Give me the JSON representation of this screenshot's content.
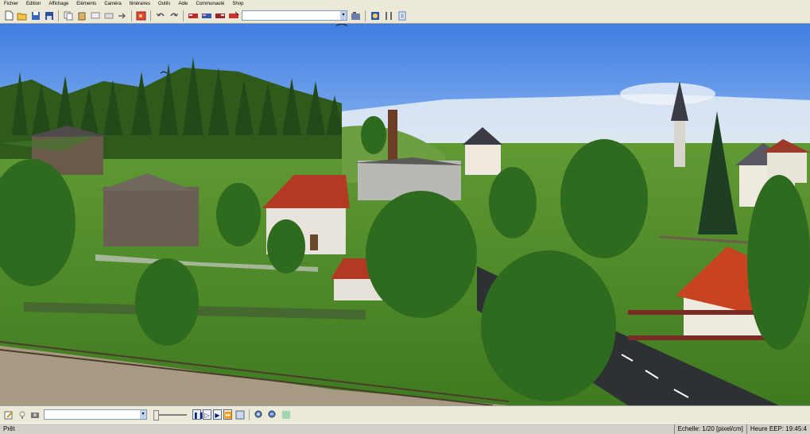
{
  "menu": {
    "items": [
      "Fichier",
      "Edition",
      "Affichage",
      "Eléments",
      "Caméra",
      "Itinéraires",
      "Outils",
      "Aide",
      "Communauté",
      "Shop"
    ]
  },
  "toolbar": {
    "icons": [
      "new-file-icon",
      "open-folder-icon",
      "save-icon",
      "save-as-icon",
      "copy-icon",
      "paste-icon",
      "cut-icon",
      "insert-icon",
      "export-icon",
      "picture-icon",
      "undo-icon",
      "redo-icon",
      "train-icon",
      "train-add-icon",
      "train-edit-icon",
      "train-remove-icon",
      "combo",
      "camera-icon",
      "sun-icon",
      "tools-icon",
      "document-icon"
    ],
    "combo_value": ""
  },
  "bottom": {
    "combo_value": "",
    "slider_level": 0
  },
  "status": {
    "text": "Prêt",
    "scale": "Echelle:  1/20 [pixel/cm]",
    "time": "Heure EEP:  19:45:4"
  },
  "colors": {
    "sky": "#4f86e0",
    "grass": "#4f8a2a",
    "road": "#2e3133",
    "roof": "#b3402a"
  }
}
